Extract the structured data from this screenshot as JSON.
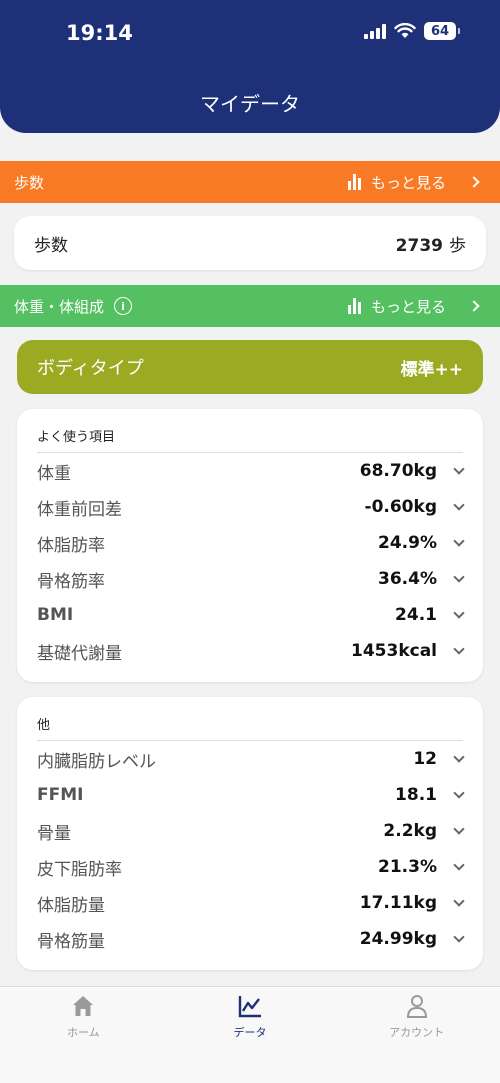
{
  "status": {
    "time": "19:14",
    "battery": "64"
  },
  "header": {
    "title": "マイデータ"
  },
  "steps_section": {
    "label": "歩数",
    "more": "もっと見る"
  },
  "steps_card": {
    "label": "歩数",
    "value": "2739",
    "unit": "歩"
  },
  "body_section": {
    "label": "体重・体組成",
    "info": "i",
    "more": "もっと見る"
  },
  "body_type": {
    "label": "ボディタイプ",
    "value": "標準++"
  },
  "frequent": {
    "title": "よく使う項目",
    "items": [
      {
        "label": "体重",
        "value": "68.70kg"
      },
      {
        "label": "体重前回差",
        "value": "-0.60kg"
      },
      {
        "label": "体脂肪率",
        "value": "24.9%"
      },
      {
        "label": "骨格筋率",
        "value": "36.4%"
      },
      {
        "label": "BMI",
        "value": "24.1"
      },
      {
        "label": "基礎代謝量",
        "value": "1453kcal"
      }
    ]
  },
  "others": {
    "title": "他",
    "items": [
      {
        "label": "内臓脂肪レベル",
        "value": "12"
      },
      {
        "label": "FFMI",
        "value": "18.1"
      },
      {
        "label": "骨量",
        "value": "2.2kg"
      },
      {
        "label": "皮下脂肪率",
        "value": "21.3%"
      },
      {
        "label": "体脂肪量",
        "value": "17.11kg"
      },
      {
        "label": "骨格筋量",
        "value": "24.99kg"
      }
    ]
  },
  "tabs": [
    {
      "label": "ホーム",
      "icon": "home-icon"
    },
    {
      "label": "データ",
      "icon": "chart-line-icon"
    },
    {
      "label": "アカウント",
      "icon": "person-icon"
    }
  ],
  "colors": {
    "header": "#1e3178",
    "steps_bar": "#f97a25",
    "body_bar": "#54c062",
    "body_type": "#9aaa22"
  }
}
